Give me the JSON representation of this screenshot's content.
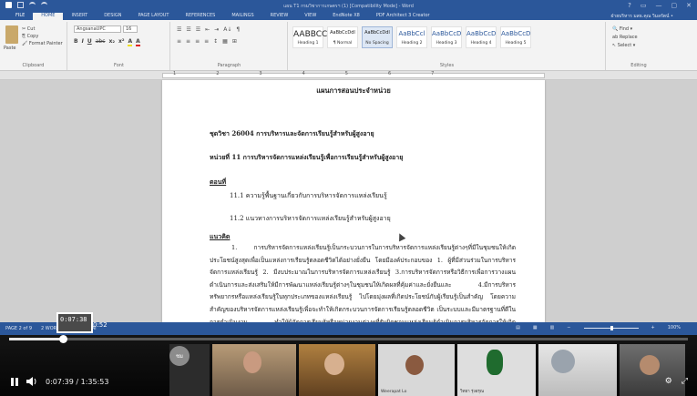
{
  "word": {
    "title": "แผน T1 กรมวิชาการเกษตรฯ (1) [Compatibility Mode] - Word",
    "window_controls": [
      "?",
      "▭",
      "—",
      "▢",
      "✕"
    ],
    "tabs": [
      "FILE",
      "HOME",
      "INSERT",
      "DESIGN",
      "PAGE LAYOUT",
      "REFERENCES",
      "MAILINGS",
      "REVIEW",
      "VIEW",
      "EndNote X8",
      "PDF Architect 3 Creator"
    ],
    "active_tab": "HOME",
    "user": "ฝ่ายบริหาร มสธ.คุณ วิมลรัตน์ •",
    "clipboard": {
      "paste": "Paste",
      "items": [
        "✂ Cut",
        "⎘ Copy",
        "🖌 Format Painter"
      ],
      "label": "Clipboard"
    },
    "font": {
      "name": "AngsanaUPC",
      "size": "16",
      "formatting": [
        "B",
        "I",
        "U",
        "abc",
        "x₂",
        "x²",
        "A",
        "A"
      ],
      "label": "Font"
    },
    "paragraph": {
      "row1": [
        "☰",
        "☰",
        "☰",
        "⇤",
        "⇥",
        "A↓",
        "¶"
      ],
      "row2": [
        "≡",
        "≡",
        "≡",
        "≡",
        "↕",
        "▦",
        "⊞"
      ],
      "label": "Paragraph"
    },
    "styles": {
      "items": [
        {
          "sample": "AABBCC",
          "name": "Heading 1"
        },
        {
          "sample": "AaBbCcDdI",
          "name": "¶ Normal"
        },
        {
          "sample": "AaBbCcDdI",
          "name": "No Spacing"
        },
        {
          "sample": "AaBbCcl",
          "name": "Heading 2"
        },
        {
          "sample": "AaBbCcD",
          "name": "Heading 3"
        },
        {
          "sample": "AaBbCcD",
          "name": "Heading 4"
        },
        {
          "sample": "AaBbCcD",
          "name": "Heading 5"
        }
      ],
      "label": "Styles"
    },
    "editing": {
      "items": [
        "🔍 Find ▾",
        "ab Replace",
        "↖ Select ▾"
      ],
      "label": "Editing"
    },
    "ruler_nums": [
      "1",
      "2",
      "3",
      "4",
      "5",
      "6",
      "7"
    ],
    "document": {
      "heading": "แผนการสอนประจำหน่วย",
      "course": "ชุดวิชา 26004   การบริหารและจัดการเรียนรู้สำหรับผู้สูงอายุ",
      "unit": "หน่วยที่ 11     การบริหารจัดการแหล่งเรียนรู้เพื่อการเรียนรู้สำหรับผู้สูงอายุ",
      "topic_label": "ตอนที่",
      "topic_1": "11.1  ความรู้พื้นฐานเกี่ยวกับการบริหารจัดการแหล่งเรียนรู้",
      "topic_2": "11.2  แนวทางการบริหารจัดการแหล่งเรียนรู้สำหรับผู้สูงอายุ",
      "concept_label": "แนวคิด",
      "concept_text": "1.  การบริหารจัดการแหล่งเรียนรู้เป็นกระบวนการในการบริหารจัดการแหล่งเรียนรู้ต่างๆที่มีในชุมชนให้เกิดประโยชน์สูงสุดเพื่อเป็นแหล่งการเรียนรู้ตลอดชีวิตได้อย่างยั่งยืน โดยมีองค์ประกอบของ 1. ผู้ที่มีส่วนร่วมในการบริหารจัดการแหล่งเรียนรู้ 2. มีงบประมาณในการบริหารจัดการแหล่งเรียนรู้ 3.การบริหารจัดการหรือวิธีการเพื่อการวางแผนดำเนินการและส่งเสริมให้มีการพัฒนาแหล่งเรียนรู้ต่างๆในชุมชนให้เกิดผลที่คุ้มค่าและยั่งยืนและ 4.มีการบริหารทรัพยากรหรือแหล่งเรียนรู้ในทุกประเภทของแหล่งเรียนรู้ ไปโดยมุ่งผลที่เกิดประโยชน์กับผู้เรียนรู้เป็นสำคัญ โดยความสำคัญของบริหารจัดการแหล่งเรียนรู้เพื่อจะทำให้เกิดกระบวนการจัดการเรียนรู้ตลอดชีวิต เป็นระบบและมีมาตรฐานที่ดีในการดำเนินงาน ทำให้ผู้จัดการเรียนรู้หรือหน่วยงานต่างๆที่รับผิดชอบแหล่งเรียนรู้ดำเนินการบริหารจัดการให้เกิดประโยชน์สูงสุดต่อชุมชนและสังคม"
    },
    "status": {
      "page": "PAGE 2 of 9",
      "words": "2 WORDS",
      "lang": "THAI",
      "zoom": "100%",
      "zoom_level": 0.5
    }
  },
  "player": {
    "current_time": "0:07:39",
    "duration": "1:35:53",
    "time_display": "0:07:39 / 1:35:53",
    "hover_time": "0:52",
    "preview_time": "0:07:38",
    "progress": 0.0798,
    "avatar_label": "ชม",
    "participants": [
      {
        "caption": ""
      },
      {
        "caption": ""
      },
      {
        "caption": ""
      },
      {
        "caption": "Weerapat Lo"
      },
      {
        "caption": "วิทยา รุ่งอรุณ"
      },
      {
        "caption": ""
      },
      {
        "caption": ""
      }
    ]
  }
}
